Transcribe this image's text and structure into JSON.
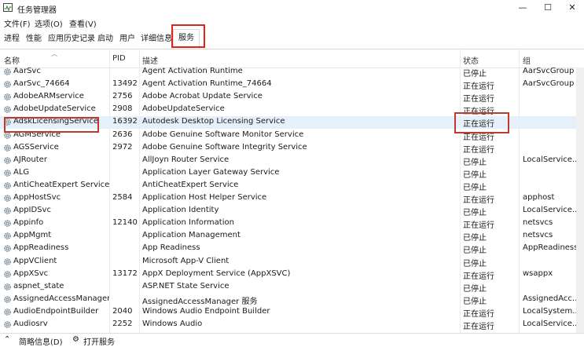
{
  "window": {
    "title": "任务管理器",
    "min": "—",
    "max": "☐",
    "close": "✕"
  },
  "menu": [
    "文件(F)",
    "选项(O)",
    "查看(V)"
  ],
  "tabs": [
    "进程",
    "性能",
    "应用历史记录",
    "启动",
    "用户",
    "详细信息",
    "服务"
  ],
  "columns": {
    "name": "名称",
    "pid": "PID",
    "desc": "描述",
    "status": "状态",
    "group": "组"
  },
  "rows": [
    {
      "name": "AarSvc",
      "pid": "",
      "desc": "Agent Activation Runtime",
      "status": "已停止",
      "group": "AarSvcGroup"
    },
    {
      "name": "AarSvc_74664",
      "pid": "13492",
      "desc": "Agent Activation Runtime_74664",
      "status": "正在运行",
      "group": "AarSvcGroup"
    },
    {
      "name": "AdobeARMservice",
      "pid": "2756",
      "desc": "Adobe Acrobat Update Service",
      "status": "正在运行",
      "group": ""
    },
    {
      "name": "AdobeUpdateService",
      "pid": "2908",
      "desc": "AdobeUpdateService",
      "status": "正在运行",
      "group": ""
    },
    {
      "name": "AdskLicensingService",
      "pid": "16392",
      "desc": "Autodesk Desktop Licensing Service",
      "status": "正在运行",
      "group": ""
    },
    {
      "name": "AGMService",
      "pid": "2636",
      "desc": "Adobe Genuine Software Monitor Service",
      "status": "正在运行",
      "group": ""
    },
    {
      "name": "AGSService",
      "pid": "2972",
      "desc": "Adobe Genuine Software Integrity Service",
      "status": "正在运行",
      "group": ""
    },
    {
      "name": "AJRouter",
      "pid": "",
      "desc": "AllJoyn Router Service",
      "status": "已停止",
      "group": "LocalService..."
    },
    {
      "name": "ALG",
      "pid": "",
      "desc": "Application Layer Gateway Service",
      "status": "已停止",
      "group": ""
    },
    {
      "name": "AntiCheatExpert Service",
      "pid": "",
      "desc": "AntiCheatExpert Service",
      "status": "已停止",
      "group": ""
    },
    {
      "name": "AppHostSvc",
      "pid": "2584",
      "desc": "Application Host Helper Service",
      "status": "正在运行",
      "group": "apphost"
    },
    {
      "name": "AppIDSvc",
      "pid": "",
      "desc": "Application Identity",
      "status": "已停止",
      "group": "LocalService..."
    },
    {
      "name": "Appinfo",
      "pid": "12140",
      "desc": "Application Information",
      "status": "正在运行",
      "group": "netsvcs"
    },
    {
      "name": "AppMgmt",
      "pid": "",
      "desc": "Application Management",
      "status": "已停止",
      "group": "netsvcs"
    },
    {
      "name": "AppReadiness",
      "pid": "",
      "desc": "App Readiness",
      "status": "已停止",
      "group": "AppReadiness"
    },
    {
      "name": "AppVClient",
      "pid": "",
      "desc": "Microsoft App-V Client",
      "status": "已停止",
      "group": ""
    },
    {
      "name": "AppXSvc",
      "pid": "13172",
      "desc": "AppX Deployment Service (AppXSVC)",
      "status": "正在运行",
      "group": "wsappx"
    },
    {
      "name": "aspnet_state",
      "pid": "",
      "desc": "ASP.NET State Service",
      "status": "已停止",
      "group": ""
    },
    {
      "name": "AssignedAccessManager...",
      "pid": "",
      "desc": "AssignedAccessManager 服务",
      "status": "已停止",
      "group": "AssignedAcc..."
    },
    {
      "name": "AudioEndpointBuilder",
      "pid": "2040",
      "desc": "Windows Audio Endpoint Builder",
      "status": "正在运行",
      "group": "LocalSystem..."
    },
    {
      "name": "Audiosrv",
      "pid": "2252",
      "desc": "Windows Audio",
      "status": "正在运行",
      "group": "LocalService..."
    }
  ],
  "footer": {
    "less": "简略信息(D)",
    "open": "打开服务"
  },
  "colors": {
    "highlight": "#e2231a",
    "selected_row": "#e6f0fa"
  }
}
